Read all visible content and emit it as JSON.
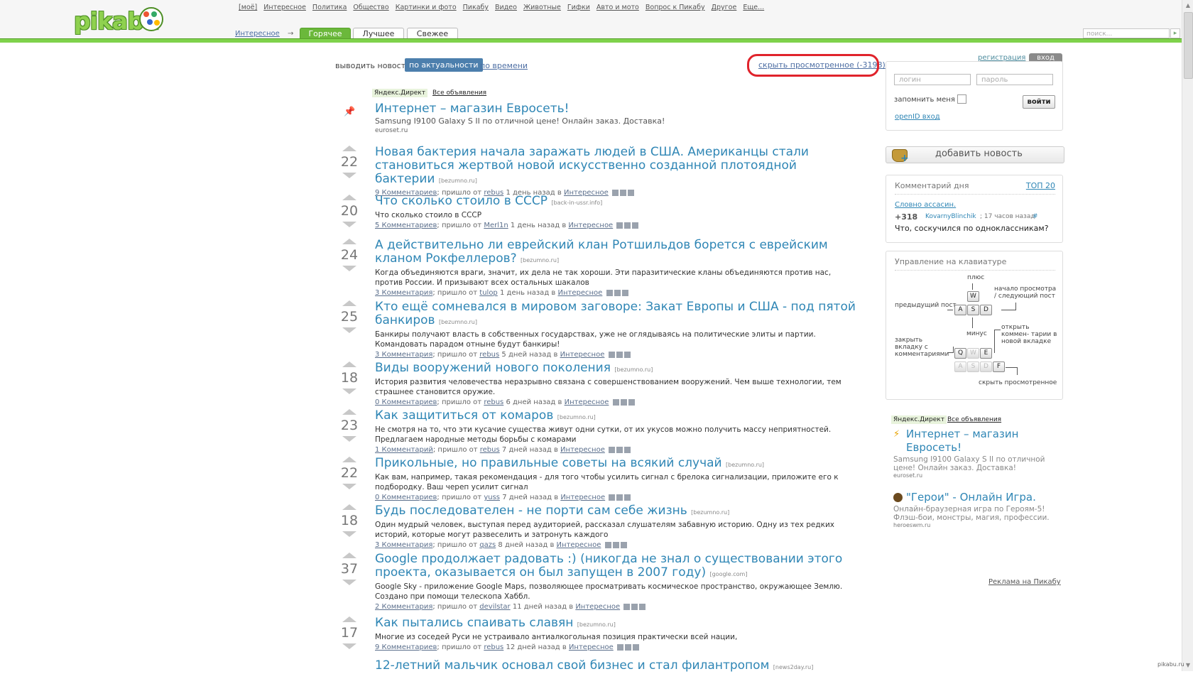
{
  "header": {
    "logo_text": "pikabu",
    "nav": [
      "[моё]",
      "Интересное",
      "Политика",
      "Общество",
      "Картинки и фото",
      "Пикабу",
      "Видео",
      "Животные",
      "Гифки",
      "Авто и мото",
      "Вопрос к Пикабу",
      "Другое",
      "Еще..."
    ],
    "breadcrumb": "Интересное",
    "breadcrumb_arrow": "→",
    "tabs": [
      "Горячее",
      "Лучшее",
      "Свежее"
    ],
    "active_tab": "Горячее",
    "search_placeholder": "поиск..."
  },
  "sort": {
    "label": "выводить новости",
    "active": "по актуальности",
    "other": "по времени",
    "hide_viewed": "скрыть просмотренное (-3198)"
  },
  "ad_top": {
    "badge": "Яндекс.Директ",
    "all_ads": "Все объявления",
    "title": "Интернет – магазин Евросеть!",
    "desc": "Samsung I9100 Galaxy S II по отличной цене! Онлайн заказ. Доставка!",
    "domain": "euroset.ru"
  },
  "posts": [
    {
      "score": "22",
      "title": "Новая бактерия начала заражать людей в США. Американцы стали становиться жертвой новой искусственно созданной плотоядной бактерии",
      "domain": "[bezumno.ru]",
      "desc": "",
      "comments": "9 Комментариев",
      "author": "rebus",
      "time": "1 день назад",
      "category": "Интересное"
    },
    {
      "score": "20",
      "title": "Что сколько стоило в СССР",
      "domain": "[back-in-ussr.info]",
      "desc": "Что сколько стоило в СССР",
      "comments": "5 Комментариев",
      "author": "Merl1n",
      "time": "1 день назад",
      "category": "Интересное"
    },
    {
      "score": "24",
      "title": "А действительно ли еврейский клан Ротшильдов борется с еврейским кланом Рокфеллеров?",
      "domain": "[bezumno.ru]",
      "desc": "Когда объединяются враги, значит, их дела не так хороши. Эти паразитические кланы объединяются против нас, против России. И призывают всех остальных шакалов",
      "comments": "3 Комментария",
      "author": "tulop",
      "time": "1 день назад",
      "category": "Интересное"
    },
    {
      "score": "25",
      "title": "Кто ещё сомневался в мировом заговоре: Закат Европы и США - под пятой банкиров",
      "domain": "[bezumno.ru]",
      "desc": "Банкиры получают власть в собственных государствах, уже не оглядываясь на политические элиты и партии. Командовать парадом отныне будут банкиры!",
      "comments": "3 Комментария",
      "author": "rebus",
      "time": "5 дней назад",
      "category": "Интересное"
    },
    {
      "score": "18",
      "title": "Виды вооружений нового поколения",
      "domain": "[bezumno.ru]",
      "desc": "История развития человечества неразрывно связана с совершенствованием вооружений. Чем выше технологии, тем страшнее становится оружие.",
      "comments": "0 Комментариев",
      "author": "rebus",
      "time": "6 дней назад",
      "category": "Интересное"
    },
    {
      "score": "23",
      "title": "Как защититься от комаров",
      "domain": "[bezumno.ru]",
      "desc": "Не смотря на то, что эти кусачие существа живут одни сутки, от их укусов можно получить массу неприятностей. Предлагаем народные методы борьбы с комарами",
      "comments": "1 Комментарий",
      "author": "rebus",
      "time": "7 дней назад",
      "category": "Интересное"
    },
    {
      "score": "22",
      "title": "Прикольные, но правильные советы на всякий случай",
      "domain": "[bezumno.ru]",
      "desc": "Как вам, например, такая рекомендация - для того чтобы усилить сигнал с брелока сигнализации, приложите его к подбородку. Ваш череп усилит сигнал",
      "comments": "0 Комментариев",
      "author": "yuss",
      "time": "7 дней назад",
      "category": "Интересное"
    },
    {
      "score": "18",
      "title": "Будь последователен - не порти сам себе жизнь",
      "domain": "[bezumno.ru]",
      "desc": "Один мудрый человек, выступая перед аудиторией, рассказал слушателям забавную историю. Одну из тех редких историй, которые могут развеселить и затронуть каждого",
      "comments": "3 Комментария",
      "author": "qazs",
      "time": "8 дней назад",
      "category": "Интересное"
    },
    {
      "score": "37",
      "title": "Google продолжает радовать :) (никогда не знал о существовании этого проекта, оказывается он был запущен в 2007 году)",
      "domain": "[google.com]",
      "desc": "Google Sky - приложение Google Maps, позволяющее просматривать космическое пространство, окружающее Землю. Создано при помощи телескопа Хаббл.",
      "comments": "2 Комментария",
      "author": "devilstar",
      "time": "11 дней назад",
      "category": "Интересное"
    },
    {
      "score": "17",
      "title": "Как пытались спаивать славян",
      "domain": "[bezumno.ru]",
      "desc": "Многие из соседей Руси не устраивало антиалкогольная позиция практически всей нации,",
      "comments": "9 Комментариев",
      "author": "rebus",
      "time": "12 дней назад",
      "category": "Интересное"
    },
    {
      "score": "",
      "title": "12-летний мальчик основал свой бизнес и стал филантропом",
      "domain": "[news2day.ru]",
      "desc": "",
      "comments": "",
      "author": "",
      "time": "",
      "category": ""
    }
  ],
  "meta_words": {
    "from": "пришло от",
    "in": "в"
  },
  "login": {
    "register": "регистрация",
    "login_tab": "вход",
    "login_placeholder": "логин",
    "password_placeholder": "пароль",
    "remember": "запомнить меня",
    "submit": "войти",
    "openid": "openID вход"
  },
  "add_news": "добавить новость",
  "comment_of_day": {
    "title": "Комментарий дня",
    "top": "ТОП 20",
    "link": "Словно ассасин.",
    "score": "+318",
    "user": "KovarnyBlinchik",
    "time": "; 17 часов назад",
    "hash": "#",
    "text": "Что, соскучился по одноклассникам?"
  },
  "keyboard": {
    "title": "Управление на клавиатуре",
    "plus": "плюс",
    "prev": "предыдущий пост",
    "next": "начало просмотра / следующий пост",
    "minus": "минус",
    "open": "открыть коммен- тарии в новой вкладке",
    "close": "закрыть вкладку с комментариями",
    "hide": "скрыть просмотренное",
    "keys": {
      "w": "W",
      "a": "A",
      "s": "S",
      "d": "D",
      "q": "Q",
      "e": "E",
      "f": "F"
    }
  },
  "ads_right": {
    "badge": "Яндекс.Директ",
    "all_ads": "Все объявления",
    "items": [
      {
        "title": "Интернет – магазин Евросеть!",
        "desc": "Samsung I9100 Galaxy S II по отличной цене! Онлайн заказ. Доставка!",
        "domain": "euroset.ru"
      },
      {
        "title": "\"Герои\" - Онлайн Игра.",
        "desc": "Онлайн-браузерная игра по Героям-5! Флэш-бои, монстры, магия, профессии.",
        "domain": "heroeswm.ru"
      }
    ],
    "pikabu_ads": "Реклама на Пикабу"
  },
  "watermark": "pikabu.ru",
  "colors": {
    "brand_green": "#7fd24b",
    "link_blue": "#2f86b5",
    "highlight_red": "#e0232b",
    "sort_active_bg": "#4c7fad"
  }
}
